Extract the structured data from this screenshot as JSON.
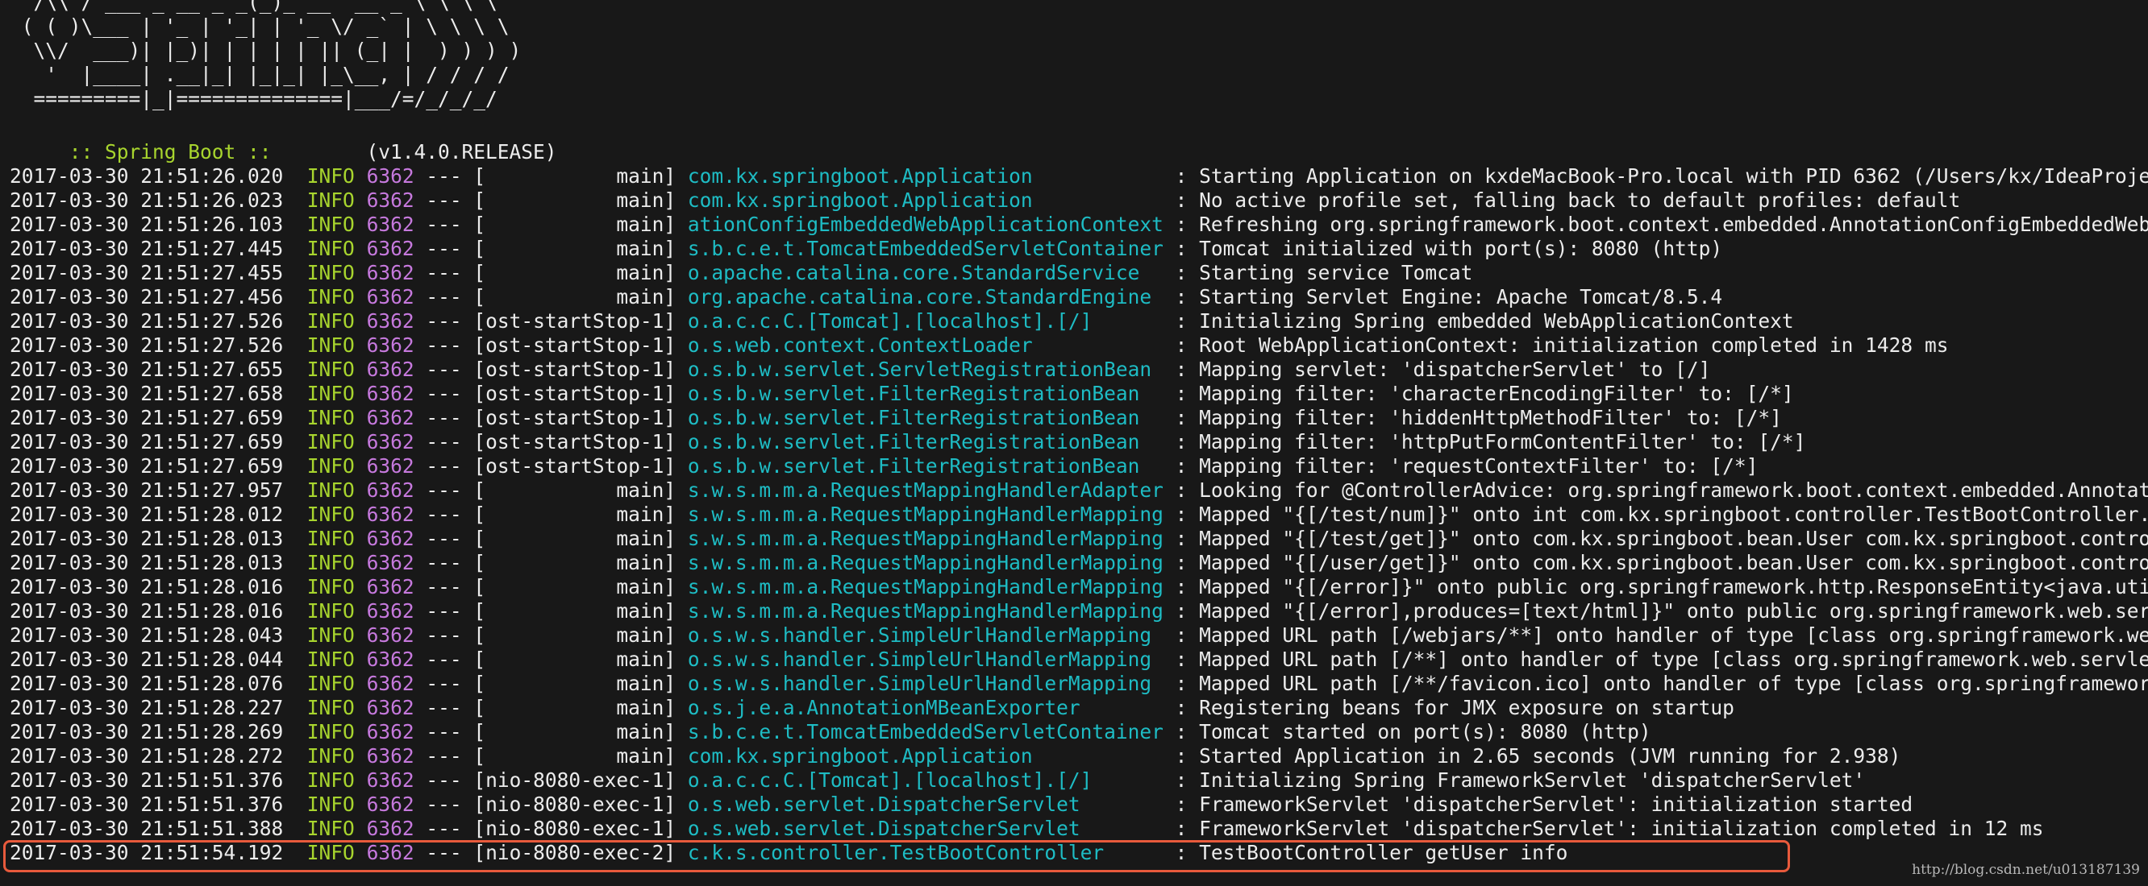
{
  "banner": {
    "ascii_lines": [
      "  /\\\\ / ___'_ __ _ _(_)_ __  __ _ \\ \\ \\ \\",
      " ( ( )\\___ | '_ | '_| | '_ \\/ _` | \\ \\ \\ \\",
      "  \\\\/  ___)| |_)| | | | | || (_| |  ) ) ) )",
      "   '  |____| .__|_| |_|_| |_\\__, | / / / /",
      "  =========|_|==============|___/=/_/_/_/"
    ],
    "boot_label": " :: Spring Boot ::",
    "boot_version": "        (v1.4.0.RELEASE)"
  },
  "log": [
    {
      "ts": "2017-03-30 21:51:26.020",
      "level": "INFO",
      "pid": "6362",
      "sep": "---",
      "thread": "[           main]",
      "logger": "com.kx.springboot.Application           ",
      "msg": " : Starting Application on kxdeMacBook-Pro.local with PID 6362 (/Users/kx/IdeaProjects/spring"
    },
    {
      "ts": "2017-03-30 21:51:26.023",
      "level": "INFO",
      "pid": "6362",
      "sep": "---",
      "thread": "[           main]",
      "logger": "com.kx.springboot.Application           ",
      "msg": " : No active profile set, falling back to default profiles: default"
    },
    {
      "ts": "2017-03-30 21:51:26.103",
      "level": "INFO",
      "pid": "6362",
      "sep": "---",
      "thread": "[           main]",
      "logger": "ationConfigEmbeddedWebApplicationContext",
      "msg": " : Refreshing org.springframework.boot.context.embedded.AnnotationConfigEmbeddedWebApplicatio"
    },
    {
      "ts": "2017-03-30 21:51:27.445",
      "level": "INFO",
      "pid": "6362",
      "sep": "---",
      "thread": "[           main]",
      "logger": "s.b.c.e.t.TomcatEmbeddedServletContainer",
      "msg": " : Tomcat initialized with port(s): 8080 (http)"
    },
    {
      "ts": "2017-03-30 21:51:27.455",
      "level": "INFO",
      "pid": "6362",
      "sep": "---",
      "thread": "[           main]",
      "logger": "o.apache.catalina.core.StandardService  ",
      "msg": " : Starting service Tomcat"
    },
    {
      "ts": "2017-03-30 21:51:27.456",
      "level": "INFO",
      "pid": "6362",
      "sep": "---",
      "thread": "[           main]",
      "logger": "org.apache.catalina.core.StandardEngine ",
      "msg": " : Starting Servlet Engine: Apache Tomcat/8.5.4"
    },
    {
      "ts": "2017-03-30 21:51:27.526",
      "level": "INFO",
      "pid": "6362",
      "sep": "---",
      "thread": "[ost-startStop-1]",
      "logger": "o.a.c.c.C.[Tomcat].[localhost].[/]      ",
      "msg": " : Initializing Spring embedded WebApplicationContext"
    },
    {
      "ts": "2017-03-30 21:51:27.526",
      "level": "INFO",
      "pid": "6362",
      "sep": "---",
      "thread": "[ost-startStop-1]",
      "logger": "o.s.web.context.ContextLoader           ",
      "msg": " : Root WebApplicationContext: initialization completed in 1428 ms"
    },
    {
      "ts": "2017-03-30 21:51:27.655",
      "level": "INFO",
      "pid": "6362",
      "sep": "---",
      "thread": "[ost-startStop-1]",
      "logger": "o.s.b.w.servlet.ServletRegistrationBean ",
      "msg": " : Mapping servlet: 'dispatcherServlet' to [/]"
    },
    {
      "ts": "2017-03-30 21:51:27.658",
      "level": "INFO",
      "pid": "6362",
      "sep": "---",
      "thread": "[ost-startStop-1]",
      "logger": "o.s.b.w.servlet.FilterRegistrationBean  ",
      "msg": " : Mapping filter: 'characterEncodingFilter' to: [/*]"
    },
    {
      "ts": "2017-03-30 21:51:27.659",
      "level": "INFO",
      "pid": "6362",
      "sep": "---",
      "thread": "[ost-startStop-1]",
      "logger": "o.s.b.w.servlet.FilterRegistrationBean  ",
      "msg": " : Mapping filter: 'hiddenHttpMethodFilter' to: [/*]"
    },
    {
      "ts": "2017-03-30 21:51:27.659",
      "level": "INFO",
      "pid": "6362",
      "sep": "---",
      "thread": "[ost-startStop-1]",
      "logger": "o.s.b.w.servlet.FilterRegistrationBean  ",
      "msg": " : Mapping filter: 'httpPutFormContentFilter' to: [/*]"
    },
    {
      "ts": "2017-03-30 21:51:27.659",
      "level": "INFO",
      "pid": "6362",
      "sep": "---",
      "thread": "[ost-startStop-1]",
      "logger": "o.s.b.w.servlet.FilterRegistrationBean  ",
      "msg": " : Mapping filter: 'requestContextFilter' to: [/*]"
    },
    {
      "ts": "2017-03-30 21:51:27.957",
      "level": "INFO",
      "pid": "6362",
      "sep": "---",
      "thread": "[           main]",
      "logger": "s.w.s.m.m.a.RequestMappingHandlerAdapter",
      "msg": " : Looking for @ControllerAdvice: org.springframework.boot.context.embedded.AnnotationConfig"
    },
    {
      "ts": "2017-03-30 21:51:28.012",
      "level": "INFO",
      "pid": "6362",
      "sep": "---",
      "thread": "[           main]",
      "logger": "s.w.s.m.m.a.RequestMappingHandlerMapping",
      "msg": " : Mapped \"{[/test/num]}\" onto int com.kx.springboot.controller.TestBootController.home()"
    },
    {
      "ts": "2017-03-30 21:51:28.013",
      "level": "INFO",
      "pid": "6362",
      "sep": "---",
      "thread": "[           main]",
      "logger": "s.w.s.m.m.a.RequestMappingHandlerMapping",
      "msg": " : Mapped \"{[/test/get]}\" onto com.kx.springboot.bean.User com.kx.springboot.controller.TestB"
    },
    {
      "ts": "2017-03-30 21:51:28.013",
      "level": "INFO",
      "pid": "6362",
      "sep": "---",
      "thread": "[           main]",
      "logger": "s.w.s.m.m.a.RequestMappingHandlerMapping",
      "msg": " : Mapped \"{[/user/get]}\" onto com.kx.springboot.bean.User com.kx.springboot.controller.UserC"
    },
    {
      "ts": "2017-03-30 21:51:28.016",
      "level": "INFO",
      "pid": "6362",
      "sep": "---",
      "thread": "[           main]",
      "logger": "s.w.s.m.m.a.RequestMappingHandlerMapping",
      "msg": " : Mapped \"{[/error]}\" onto public org.springframework.http.ResponseEntity<java.util.Map<java"
    },
    {
      "ts": "2017-03-30 21:51:28.016",
      "level": "INFO",
      "pid": "6362",
      "sep": "---",
      "thread": "[           main]",
      "logger": "s.w.s.m.m.a.RequestMappingHandlerMapping",
      "msg": " : Mapped \"{[/error],produces=[text/html]}\" onto public org.springframework.web.servlet.Model"
    },
    {
      "ts": "2017-03-30 21:51:28.043",
      "level": "INFO",
      "pid": "6362",
      "sep": "---",
      "thread": "[           main]",
      "logger": "o.s.w.s.handler.SimpleUrlHandlerMapping ",
      "msg": " : Mapped URL path [/webjars/**] onto handler of type [class org.springframework.web.servlet"
    },
    {
      "ts": "2017-03-30 21:51:28.044",
      "level": "INFO",
      "pid": "6362",
      "sep": "---",
      "thread": "[           main]",
      "logger": "o.s.w.s.handler.SimpleUrlHandlerMapping ",
      "msg": " : Mapped URL path [/**] onto handler of type [class org.springframework.web.servlet.resource"
    },
    {
      "ts": "2017-03-30 21:51:28.076",
      "level": "INFO",
      "pid": "6362",
      "sep": "---",
      "thread": "[           main]",
      "logger": "o.s.w.s.handler.SimpleUrlHandlerMapping ",
      "msg": " : Mapped URL path [/**/favicon.ico] onto handler of type [class org.springframework.web.serv"
    },
    {
      "ts": "2017-03-30 21:51:28.227",
      "level": "INFO",
      "pid": "6362",
      "sep": "---",
      "thread": "[           main]",
      "logger": "o.s.j.e.a.AnnotationMBeanExporter       ",
      "msg": " : Registering beans for JMX exposure on startup"
    },
    {
      "ts": "2017-03-30 21:51:28.269",
      "level": "INFO",
      "pid": "6362",
      "sep": "---",
      "thread": "[           main]",
      "logger": "s.b.c.e.t.TomcatEmbeddedServletContainer",
      "msg": " : Tomcat started on port(s): 8080 (http)"
    },
    {
      "ts": "2017-03-30 21:51:28.272",
      "level": "INFO",
      "pid": "6362",
      "sep": "---",
      "thread": "[           main]",
      "logger": "com.kx.springboot.Application           ",
      "msg": " : Started Application in 2.65 seconds (JVM running for 2.938)"
    },
    {
      "ts": "2017-03-30 21:51:51.376",
      "level": "INFO",
      "pid": "6362",
      "sep": "---",
      "thread": "[nio-8080-exec-1]",
      "logger": "o.a.c.c.C.[Tomcat].[localhost].[/]      ",
      "msg": " : Initializing Spring FrameworkServlet 'dispatcherServlet'"
    },
    {
      "ts": "2017-03-30 21:51:51.376",
      "level": "INFO",
      "pid": "6362",
      "sep": "---",
      "thread": "[nio-8080-exec-1]",
      "logger": "o.s.web.servlet.DispatcherServlet       ",
      "msg": " : FrameworkServlet 'dispatcherServlet': initialization started"
    },
    {
      "ts": "2017-03-30 21:51:51.388",
      "level": "INFO",
      "pid": "6362",
      "sep": "---",
      "thread": "[nio-8080-exec-1]",
      "logger": "o.s.web.servlet.DispatcherServlet       ",
      "msg": " : FrameworkServlet 'dispatcherServlet': initialization completed in 12 ms"
    },
    {
      "ts": "2017-03-30 21:51:54.192",
      "level": "INFO",
      "pid": "6362",
      "sep": "---",
      "thread": "[nio-8080-exec-2]",
      "logger": "c.k.s.controller.TestBootController     ",
      "msg": " : TestBootController getUser info"
    }
  ],
  "watermark": "http://blog.csdn.net/u013187139",
  "colors": {
    "background": "#181818",
    "text": "#ececec",
    "level_info": "#a8d52e",
    "pid": "#c679dd",
    "logger": "#1ebcc4",
    "highlight_border": "#e85a3c"
  }
}
